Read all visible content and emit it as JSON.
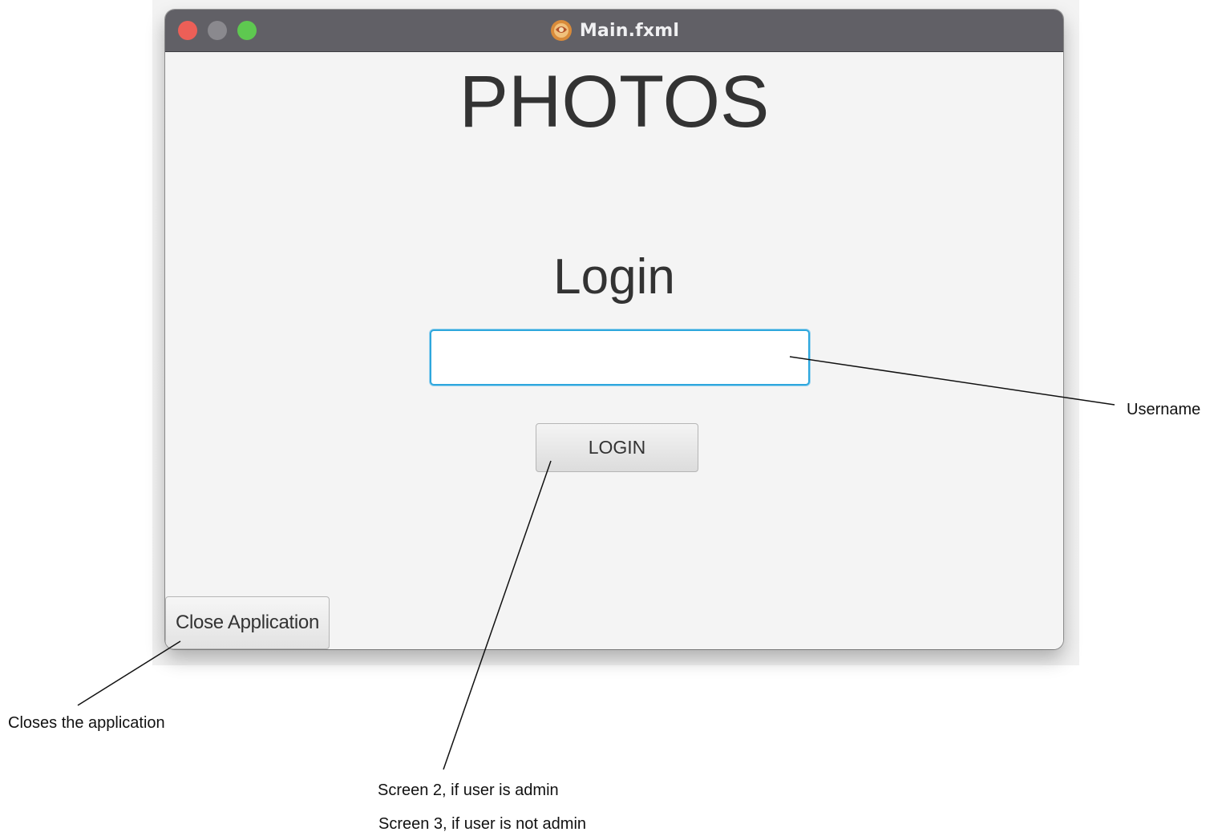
{
  "window": {
    "title": "Main.fxml",
    "app_icon": "java-duke-icon"
  },
  "main": {
    "app_title": "PHOTOS",
    "login_heading": "Login",
    "username_input": {
      "value": "",
      "placeholder": ""
    },
    "login_button_label": "LOGIN",
    "close_button_label": "Close Application"
  },
  "annotations": {
    "username": "Username",
    "close_app": "Closes the application",
    "screen2": "Screen 2, if user is admin",
    "screen3": "Screen 3, if user is not admin"
  },
  "colors": {
    "titlebar": "#616066",
    "close_traffic": "#ec5f57",
    "minimize_traffic": "#8a898e",
    "maximize_traffic": "#5ec850",
    "focus_ring": "#2ea7dd",
    "content_background": "#f4f4f4"
  }
}
